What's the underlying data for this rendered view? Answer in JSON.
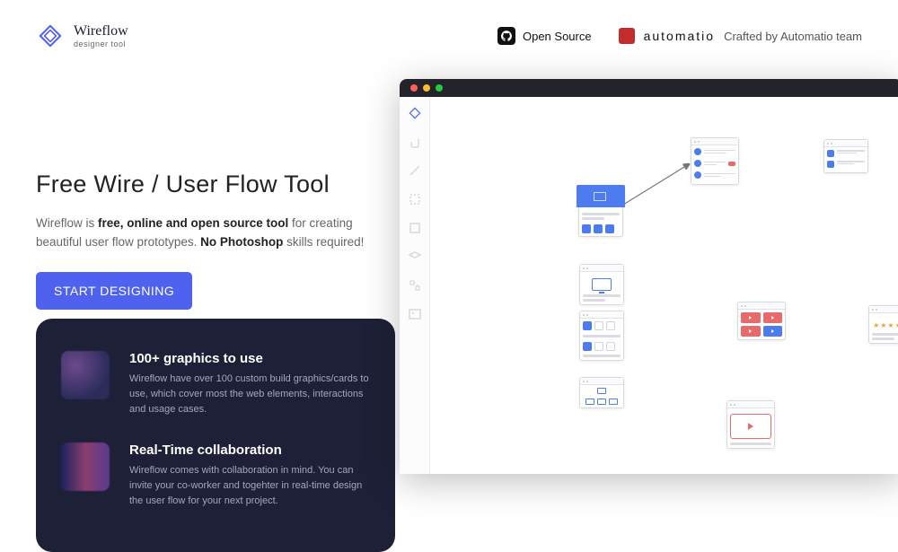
{
  "brand": {
    "name": "Wireflow",
    "tagline": "designer tool"
  },
  "nav": {
    "open_source_label": "Open Source",
    "automatio_brand": "automatio",
    "credit_text": "Crafted by Automatio team"
  },
  "hero": {
    "title": "Free Wire / User Flow Tool",
    "sub_lead": "Wireflow is ",
    "sub_bold1": "free, online and open source tool",
    "sub_mid": " for creating beautiful user flow prototypes. ",
    "sub_bold2": "No Photoshop",
    "sub_tail": " skills required!",
    "cta": "START DESIGNING"
  },
  "features": [
    {
      "title": "100+ graphics to use",
      "desc": "Wireflow have over 100 custom build graphics/cards to use, which cover most the web elements, interactions and usage cases."
    },
    {
      "title": "Real-Time collaboration",
      "desc": "Wireflow comes with collaboration in mind. You can invite your co-worker and togehter in real-time design the user flow for your next project."
    }
  ]
}
